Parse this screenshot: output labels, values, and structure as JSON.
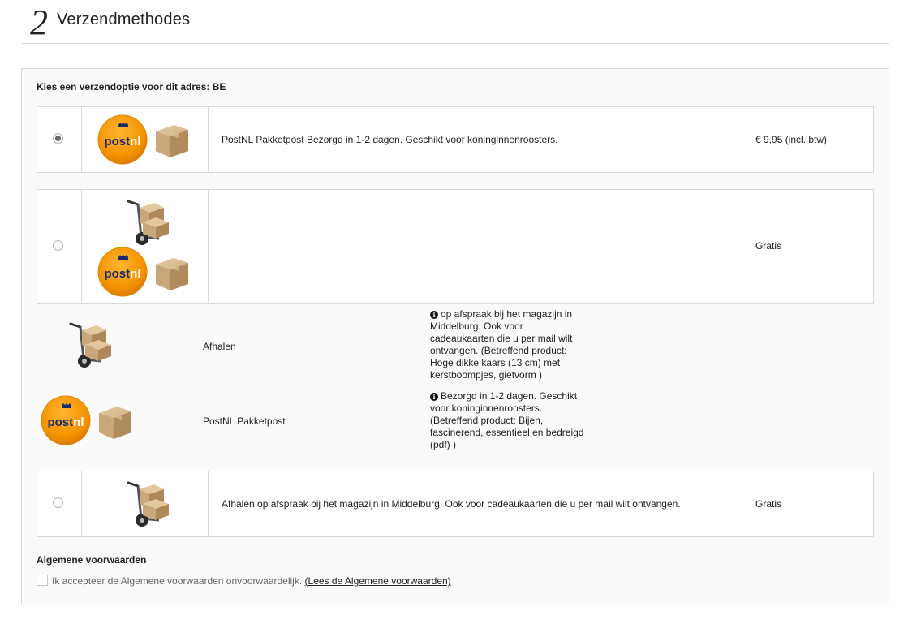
{
  "header": {
    "step": "2",
    "title": "Verzendmethodes"
  },
  "shipping": {
    "choose_label": "Kies een verzendoptie voor dit adres: BE",
    "options": [
      {
        "selected": true,
        "description": "PostNL Pakketpost Bezorgd in 1-2 dagen. Geschikt voor koninginnenroosters.",
        "price": "€ 9,95 (incl. btw)",
        "icons": [
          "postnl-logo",
          "parcel-box"
        ]
      },
      {
        "selected": false,
        "description": "",
        "price": "Gratis",
        "icons": [
          "hand-truck",
          "postnl-logo",
          "parcel-box"
        ]
      },
      {
        "selected": false,
        "description": "Afhalen op afspraak bij het magazijn in Middelburg. Ook voor cadeaukaarten die u per mail wilt ontvangen.",
        "price": "Gratis",
        "icons": [
          "hand-truck"
        ]
      }
    ],
    "combined_details": [
      {
        "name": "Afhalen",
        "info": "op afspraak bij het magazijn in Middelburg. Ook voor cadeaukaarten die u per mail wilt ontvangen. (Betreffend product: Hoge dikke kaars (13 cm) met kerstboompjes, gietvorm )",
        "icons": [
          "hand-truck"
        ]
      },
      {
        "name": "PostNL Pakketpost",
        "info": "Bezorgd in 1-2 dagen. Geschikt voor koninginnenroosters. (Betreffend product: Bijen, fascinerend, essentieel en bedreigd (pdf) )",
        "icons": [
          "postnl-logo",
          "parcel-box"
        ]
      }
    ],
    "postnl_logo_text": "postnl"
  },
  "terms": {
    "title": "Algemene voorwaarden",
    "accept_text": "Ik accepteer de Algemene voorwaarden onvoorwaardelijk.",
    "link_text": "(Lees de Algemene voorwaarden)",
    "checked": false
  },
  "colors": {
    "postnl_orange": "#f39200",
    "postnl_blue": "#1a2a6c",
    "box": "#c9a77a"
  }
}
